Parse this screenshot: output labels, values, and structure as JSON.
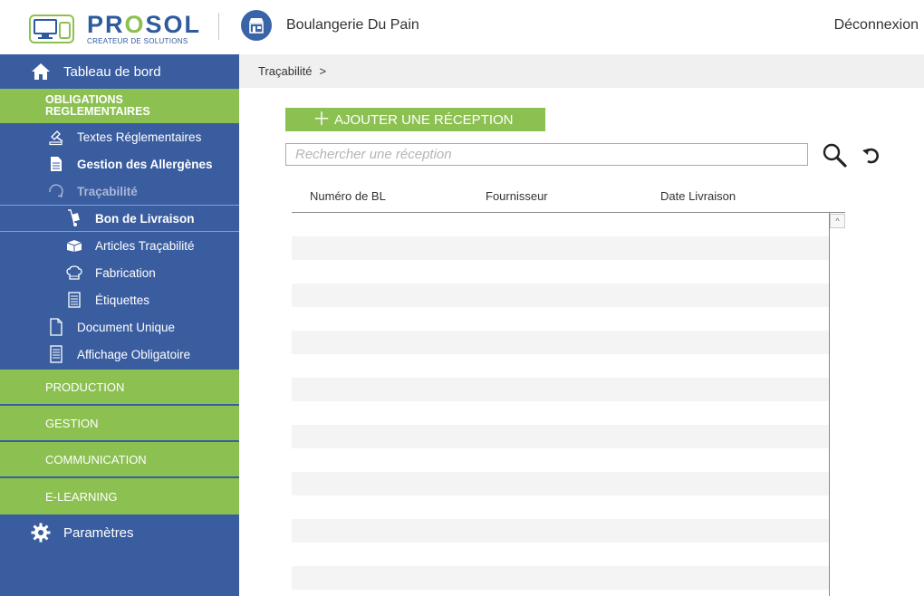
{
  "header": {
    "logo_name_pre": "PR",
    "logo_name_o": "O",
    "logo_name_post": "SOL",
    "logo_sub": "CREATEUR DE SOLUTIONS",
    "shop_name": "Boulangerie Du Pain",
    "logout_label": "Déconnexion"
  },
  "sidebar": {
    "dashboard": "Tableau de bord",
    "section_oblig_line1": "OBLIGATIONS",
    "section_oblig_line2": "REGLEMENTAIRES",
    "items": {
      "textes": "Textes Réglementaires",
      "allergenes": "Gestion des Allergènes",
      "tracabilite": "Traçabilité",
      "bon_livraison": "Bon de Livraison",
      "articles": "Articles Traçabilité",
      "fabrication": "Fabrication",
      "etiquettes": "Étiquettes",
      "document_unique": "Document Unique",
      "affichage": "Affichage Obligatoire"
    },
    "sections": {
      "production": "PRODUCTION",
      "gestion": "GESTION",
      "communication": "COMMUNICATION",
      "elearning": "E-LEARNING"
    },
    "params": "Paramètres"
  },
  "breadcrumb": {
    "item": "Traçabilité",
    "separator": ">"
  },
  "main": {
    "add_button": "AJOUTER UNE RÉCEPTION",
    "search_placeholder": "Rechercher une réception",
    "columns": [
      "Numéro de BL",
      "Fournisseur",
      "Date Livraison"
    ]
  },
  "colors": {
    "sidebar_blue": "#3a5da0",
    "accent_green": "#8cc152",
    "brand_blue": "#2e5a9e"
  },
  "icons": [
    "home-icon",
    "gavel-icon",
    "document-icon",
    "refresh-icon",
    "hand-truck-icon",
    "box-icon",
    "chef-hat-icon",
    "label-icon",
    "file-icon",
    "list-document-icon",
    "gear-icon",
    "search-icon",
    "reset-icon",
    "shop-icon"
  ]
}
